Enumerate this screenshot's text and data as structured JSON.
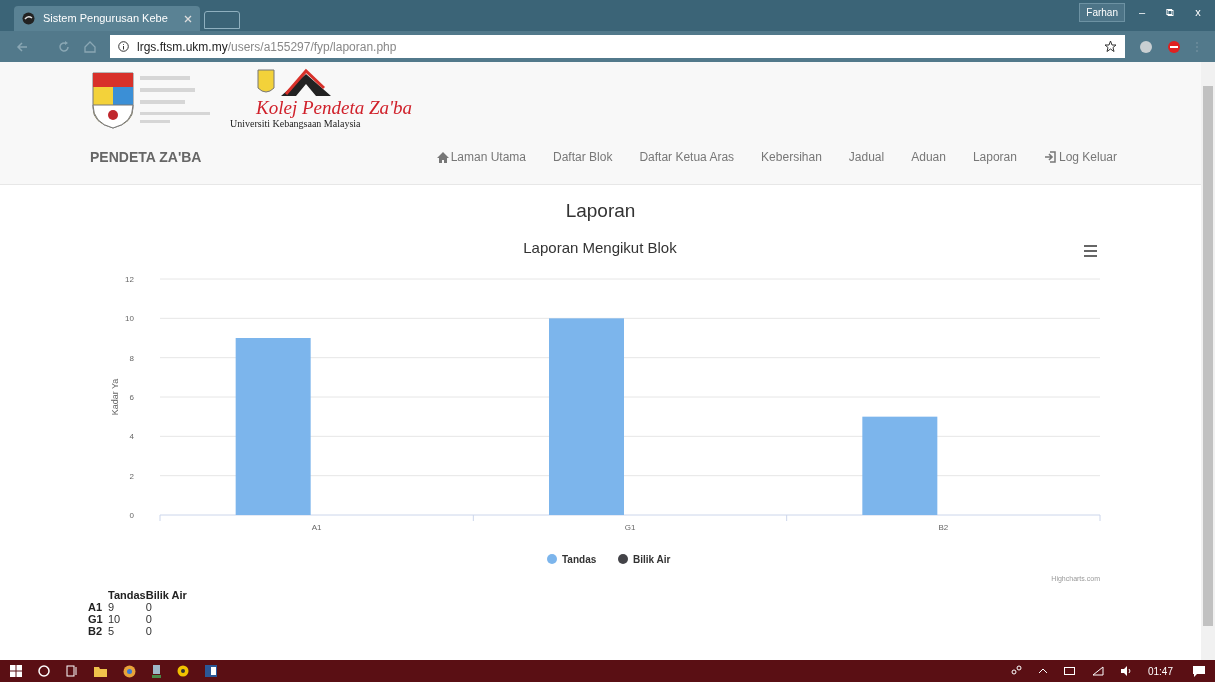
{
  "browser": {
    "tab_title": "Sistem Pengurusan Kebe",
    "url_host": "lrgs.ftsm.ukm.my",
    "url_path": "/users/a155297/fyp/laporan.php",
    "profile": "Farhan",
    "window_buttons": [
      "–",
      "⧉",
      "x"
    ]
  },
  "header": {
    "logo_title": "Kolej Pendeta Za'ba",
    "logo_subtitle": "Universiti Kebangsaan Malaysia",
    "brand": "PENDETA ZA'BA"
  },
  "nav": [
    {
      "label": "Laman Utama",
      "kind": "home"
    },
    {
      "label": "Daftar Blok",
      "kind": "plain"
    },
    {
      "label": "Daftar Ketua Aras",
      "kind": "plain"
    },
    {
      "label": "Kebersihan",
      "kind": "plain"
    },
    {
      "label": "Jadual",
      "kind": "plain"
    },
    {
      "label": "Aduan",
      "kind": "plain"
    },
    {
      "label": "Laporan",
      "kind": "plain"
    },
    {
      "label": "Log Keluar",
      "kind": "logout"
    }
  ],
  "page_title": "Laporan",
  "chart": {
    "credit": "Highcharts.com",
    "chart_data": {
      "type": "bar",
      "orientation": "vertical",
      "grid": true,
      "title": "Laporan Mengikut Blok",
      "ylabel": "Kadar Ya",
      "categories": [
        "A1",
        "G1",
        "B2"
      ],
      "ylim": [
        0,
        12
      ],
      "yticks": [
        0,
        2,
        4,
        6,
        8,
        10,
        12
      ],
      "series": [
        {
          "name": "Tandas",
          "color": "#7cb5ec",
          "values": [
            9,
            10,
            5
          ]
        },
        {
          "name": "Bilik Air",
          "color": "#434348",
          "values": [
            0,
            0,
            0
          ]
        }
      ]
    }
  },
  "table": {
    "columns": [
      "Tandas",
      "Bilik Air"
    ],
    "rows": [
      {
        "label": "A1",
        "values": [
          "9",
          "0"
        ]
      },
      {
        "label": "G1",
        "values": [
          "10",
          "0"
        ]
      },
      {
        "label": "B2",
        "values": [
          "5",
          "0"
        ]
      }
    ]
  },
  "taskbar": {
    "time": "01:47"
  }
}
